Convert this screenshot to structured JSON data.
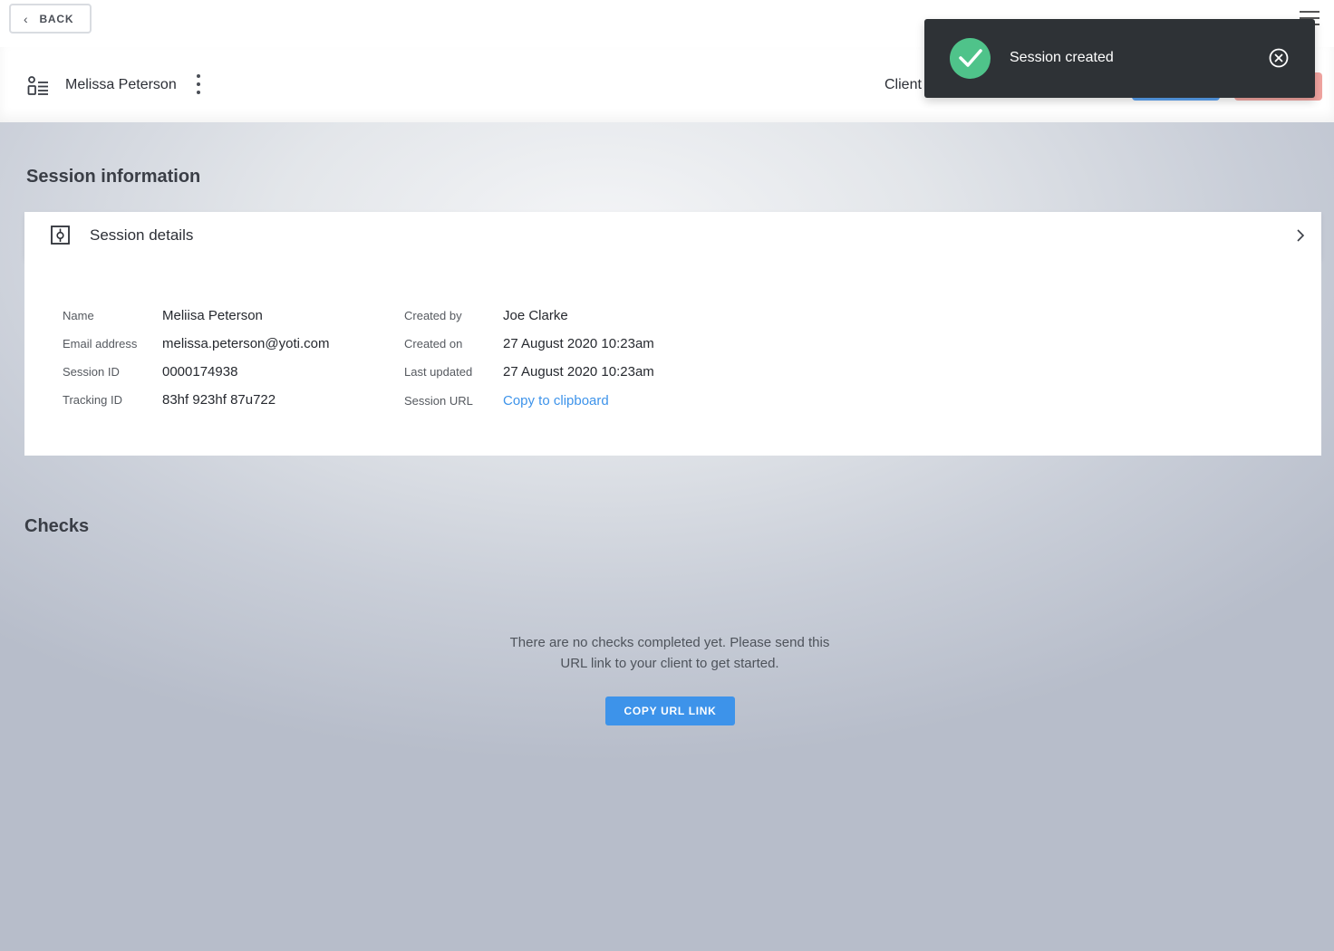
{
  "topbar": {
    "back_label": "BACK"
  },
  "client": {
    "name": "Melissa Peterson",
    "label": "Client"
  },
  "toast": {
    "message": "Session created",
    "status": "success",
    "status_color": "#4fc38a"
  },
  "session_info": {
    "heading": "Session information",
    "card_title": "Session details",
    "left_fields": [
      {
        "label": "Name",
        "value": "Meliisa Peterson"
      },
      {
        "label": "Email address",
        "value": "melissa.peterson@yoti.com"
      },
      {
        "label": "Session ID",
        "value": "0000174938"
      },
      {
        "label": "Tracking ID",
        "value": "83hf 923hf 87u722"
      }
    ],
    "right_fields": [
      {
        "label": "Created by",
        "value": "Joe Clarke"
      },
      {
        "label": "Created on",
        "value": "27 August 2020 10:23am"
      },
      {
        "label": "Last updated",
        "value": "27 August 2020 10:23am"
      },
      {
        "label": "Session URL",
        "value": "Copy to clipboard"
      }
    ]
  },
  "checks": {
    "heading": "Checks",
    "empty_line1": "There are no checks completed yet. Please send this",
    "empty_line2": "URL link to your client to get started.",
    "button_label": "COPY URL LINK"
  },
  "colors": {
    "accent": "#3d93ea",
    "danger_light": "#f1a4a0",
    "toast_bg": "#2e3236"
  }
}
